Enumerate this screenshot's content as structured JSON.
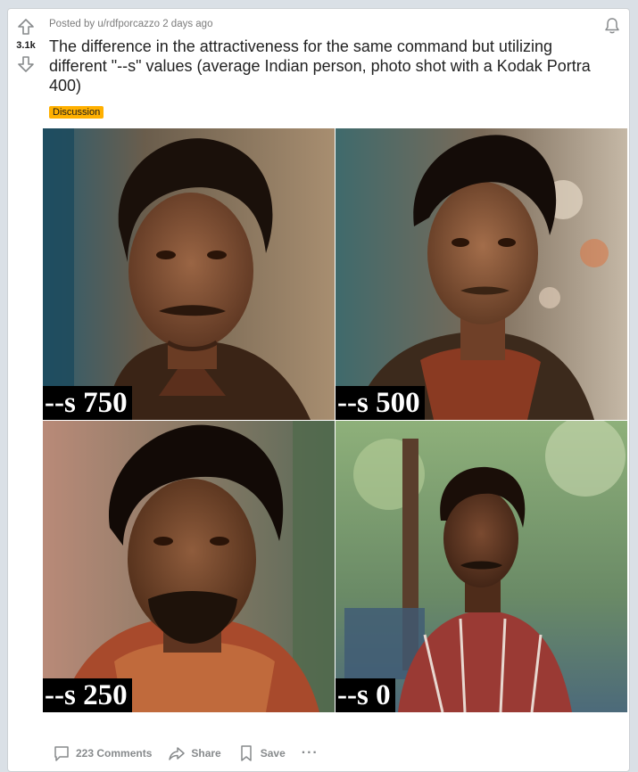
{
  "post": {
    "score": "3.1k",
    "meta": "Posted by u/rdfporcazzo 2 days ago",
    "title": "The difference in the attractiveness for the same command but utilizing different \"--s\" values (average Indian person, photo shot with a Kodak Portra 400)",
    "flair": "Discussion",
    "flair_color": "#ffb000"
  },
  "images": [
    {
      "label": "--s 750"
    },
    {
      "label": "--s 500"
    },
    {
      "label": "--s 250"
    },
    {
      "label": "--s 0"
    }
  ],
  "actions": {
    "comments": "223 Comments",
    "share": "Share",
    "save": "Save",
    "more": "···"
  },
  "icons": {
    "upvote": "arrow-up-icon",
    "downvote": "arrow-down-icon",
    "notifications": "bell-icon",
    "comments": "comment-icon",
    "share": "share-icon",
    "save": "bookmark-icon",
    "more": "more-icon"
  }
}
